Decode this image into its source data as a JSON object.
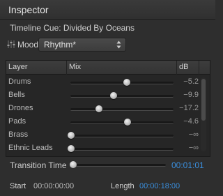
{
  "window": {
    "title": "Inspector"
  },
  "cue": {
    "label": "Timeline Cue: Divided By Oceans"
  },
  "mood": {
    "label": "Mood",
    "selected": "Rhythm*",
    "icon": "sliders-icon"
  },
  "table": {
    "headers": [
      "Layer",
      "Mix",
      "dB"
    ],
    "rows": [
      {
        "layer": "Drums",
        "mix": 0.54,
        "db": "−5.2"
      },
      {
        "layer": "Bells",
        "mix": 0.41,
        "db": "−9.9"
      },
      {
        "layer": "Drones",
        "mix": 0.27,
        "db": "−17.2"
      },
      {
        "layer": "Pads",
        "mix": 0.55,
        "db": "−4.6"
      },
      {
        "layer": "Brass",
        "mix": 0.0,
        "db": "−∞"
      },
      {
        "layer": "Ethnic Leads",
        "mix": 0.0,
        "db": "−∞"
      }
    ]
  },
  "transition": {
    "label": "Transition Time",
    "value": "00:01:01",
    "level": 0.03
  },
  "footer": {
    "start_label": "Start",
    "start_value": "00:00:00:00",
    "length_label": "Length",
    "length_value": "00:00:18:00"
  },
  "colors": {
    "accent": "#3a8fde",
    "background": "#2e2e2e"
  }
}
